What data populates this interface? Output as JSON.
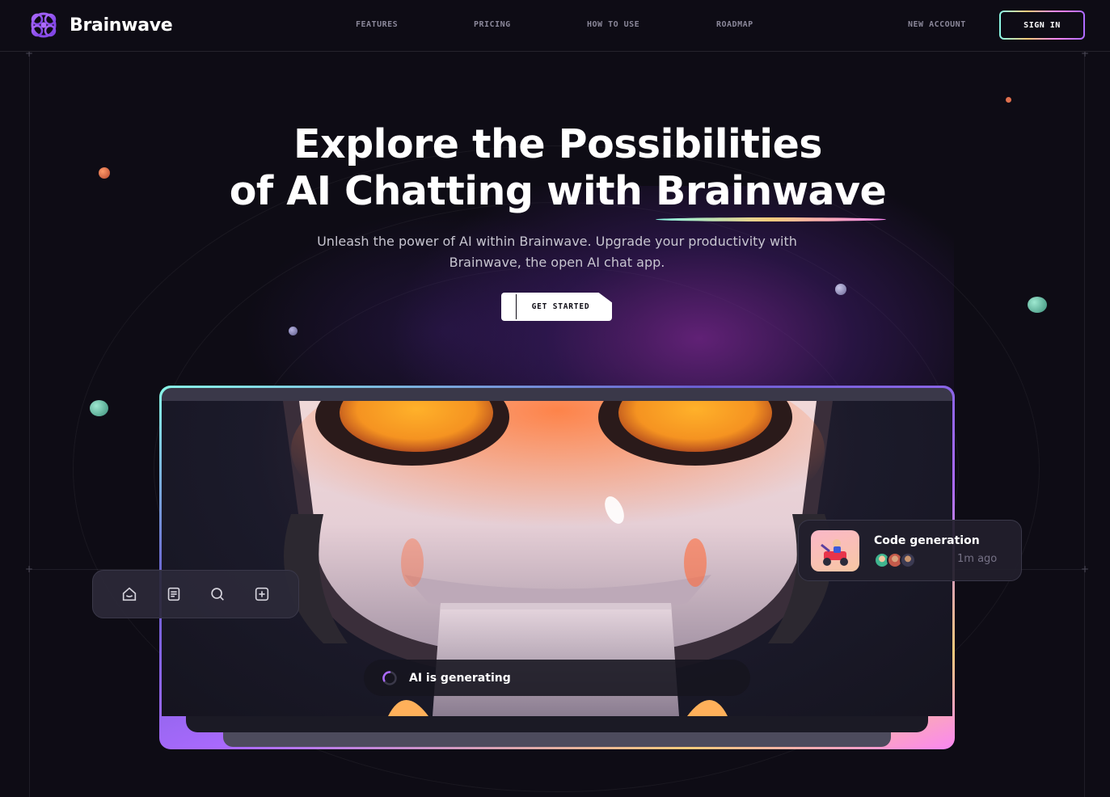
{
  "brand": {
    "name": "Brainwave"
  },
  "nav": {
    "links": [
      "Features",
      "Pricing",
      "How to use",
      "Roadmap"
    ],
    "new_account": "New account",
    "sign_in": "Sign in"
  },
  "hero": {
    "title_line1": "Explore the Possibilities",
    "title_line2_prefix": "of AI Chatting with ",
    "title_highlight": "Brainwave",
    "subtitle_line1": "Unleash the power of AI within Brainwave. Upgrade your productivity with",
    "subtitle_line2": "Brainwave, the open AI chat app.",
    "cta": "Get started"
  },
  "toolbar": {
    "icons": [
      "home-icon",
      "document-icon",
      "search-icon",
      "add-icon"
    ]
  },
  "notification": {
    "title": "Code generation",
    "time": "1m ago"
  },
  "generating": {
    "text": "AI is generating"
  },
  "colors": {
    "background": "#0e0c15",
    "accent_purple": "#ac6aff",
    "gradient": [
      "#89f9e8",
      "#facb7b",
      "#fa87f2"
    ],
    "robot_eye": "#f7a23a"
  }
}
